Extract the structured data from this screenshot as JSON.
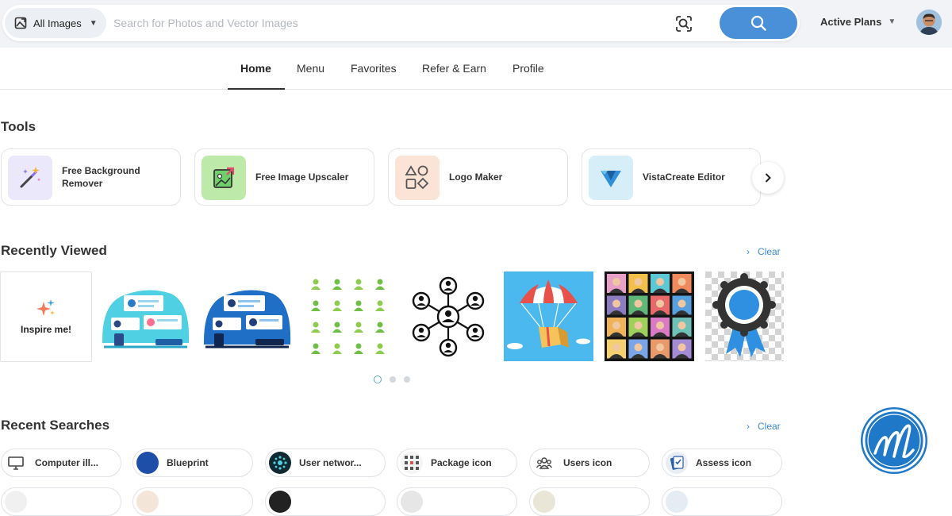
{
  "header": {
    "filter_label": "All Images",
    "search_placeholder": "Search for Photos and Vector Images",
    "plans_label": "Active Plans"
  },
  "nav": {
    "tabs": [
      {
        "label": "Home",
        "active": true
      },
      {
        "label": "Menu"
      },
      {
        "label": "Favorites"
      },
      {
        "label": "Refer & Earn"
      },
      {
        "label": "Profile"
      }
    ]
  },
  "tools": {
    "title": "Tools",
    "items": [
      {
        "label": "Free Background Remover",
        "icon": "magic-wand-icon",
        "bg": "#ece8fb"
      },
      {
        "label": "Free Image Upscaler",
        "icon": "image-upscale-icon",
        "bg": "#bdeaa8"
      },
      {
        "label": "Logo Maker",
        "icon": "shapes-icon",
        "bg": "#fbe3d6"
      },
      {
        "label": "VistaCreate Editor",
        "icon": "vistacreate-logo-icon",
        "bg": "#d6eef8"
      }
    ]
  },
  "recently_viewed": {
    "title": "Recently Viewed",
    "clear_label": "Clear",
    "inspire_label": "Inspire me!",
    "items": [
      {
        "icon": "team-meeting-illustration"
      },
      {
        "icon": "team-meeting-illustration-dark"
      },
      {
        "icon": "user-icons-grid"
      },
      {
        "icon": "user-network-icon"
      },
      {
        "icon": "parachute-package-icon"
      },
      {
        "icon": "avatars-grid"
      },
      {
        "icon": "award-ribbon-icon"
      }
    ],
    "pages": 3,
    "active_page": 1
  },
  "recent_searches": {
    "title": "Recent Searches",
    "clear_label": "Clear",
    "items": [
      {
        "label": "Computer ill...",
        "icon": "computer-icon"
      },
      {
        "label": "Blueprint",
        "icon": "blueprint-icon"
      },
      {
        "label": "User networ...",
        "icon": "user-network-icon"
      },
      {
        "label": "Package icon",
        "icon": "package-icon"
      },
      {
        "label": "Users icon",
        "icon": "users-icon"
      },
      {
        "label": "Assess icon",
        "icon": "assess-icon"
      }
    ]
  },
  "colors": {
    "accent": "#4a90d9",
    "link": "#3b8ad9",
    "brand_badge": "#1f78c8"
  }
}
